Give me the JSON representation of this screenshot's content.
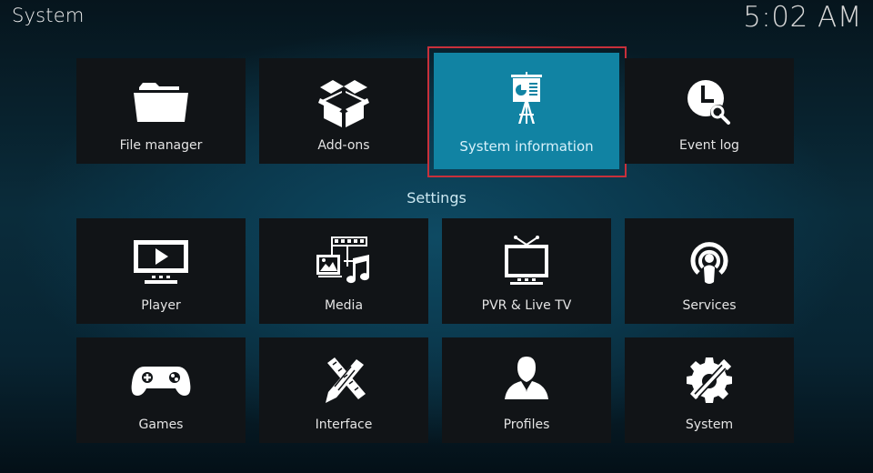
{
  "header": {
    "title": "System",
    "clock": "5:02 AM"
  },
  "top_row": [
    {
      "label": "File manager",
      "icon": "folder-icon"
    },
    {
      "label": "Add-ons",
      "icon": "open-box-icon"
    },
    {
      "label": "System information",
      "icon": "presentation-board-icon",
      "focused": true
    },
    {
      "label": "Event log",
      "icon": "clock-search-icon"
    }
  ],
  "settings": {
    "heading": "Settings",
    "items": [
      {
        "label": "Player",
        "icon": "monitor-play-icon"
      },
      {
        "label": "Media",
        "icon": "media-film-picture-music-icon"
      },
      {
        "label": "PVR & Live TV",
        "icon": "tv-antenna-icon"
      },
      {
        "label": "Services",
        "icon": "broadcast-podcast-icon"
      },
      {
        "label": "Games",
        "icon": "gamepad-icon"
      },
      {
        "label": "Interface",
        "icon": "pencil-ruler-icon"
      },
      {
        "label": "Profiles",
        "icon": "person-silhouette-icon"
      },
      {
        "label": "System",
        "icon": "gear-wrench-icon"
      }
    ]
  },
  "colors": {
    "focus_tile": "#1183a3",
    "focus_outline": "#c8303b",
    "tile_bg": "#111417"
  }
}
